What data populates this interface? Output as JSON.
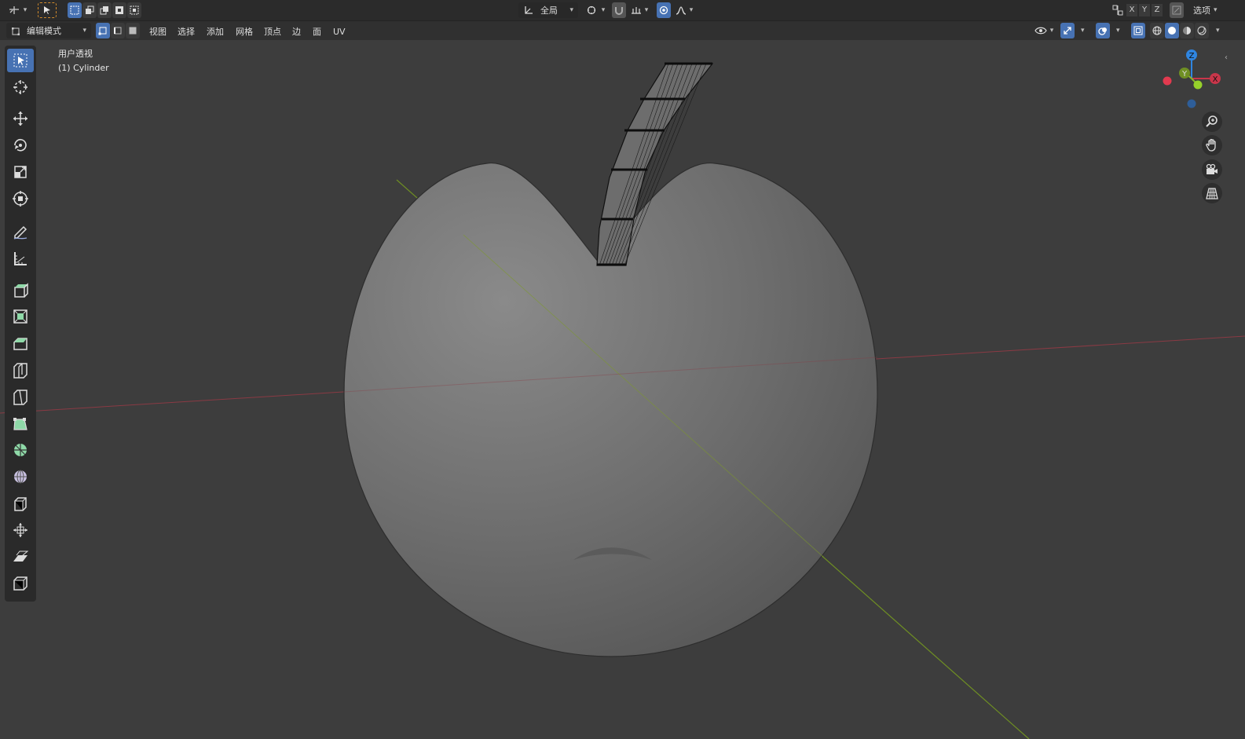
{
  "header": {
    "mode_label": "编辑模式",
    "menus": [
      "视图",
      "选择",
      "添加",
      "网格",
      "顶点",
      "边",
      "面",
      "UV"
    ]
  },
  "topbar": {
    "orientation_label": "全局",
    "axes": [
      "X",
      "Y",
      "Z"
    ],
    "options_label": "选项"
  },
  "viewport": {
    "view_name": "用户透视",
    "object_name": "(1) Cylinder",
    "gizmo": {
      "x": "X",
      "y": "Y",
      "z": "Z"
    }
  },
  "colors": {
    "accent": "#4772b3",
    "x_axis": "#c9364a",
    "y_axis": "#8ab82a",
    "z_axis": "#2f85e0"
  },
  "tools": [
    {
      "name": "select-box-tool"
    },
    {
      "name": "cursor-tool"
    },
    {
      "name": "move-tool"
    },
    {
      "name": "rotate-tool"
    },
    {
      "name": "scale-tool"
    },
    {
      "name": "transform-tool"
    },
    {
      "name": "annotate-tool"
    },
    {
      "name": "measure-tool"
    },
    {
      "name": "extrude-tool"
    },
    {
      "name": "inset-faces-tool"
    },
    {
      "name": "bevel-tool"
    },
    {
      "name": "loop-cut-tool"
    },
    {
      "name": "knife-tool"
    },
    {
      "name": "poly-build-tool"
    },
    {
      "name": "spin-tool"
    },
    {
      "name": "smooth-tool"
    },
    {
      "name": "edge-slide-tool"
    },
    {
      "name": "shrink-fatten-tool"
    },
    {
      "name": "shear-tool"
    },
    {
      "name": "rip-region-tool"
    }
  ]
}
